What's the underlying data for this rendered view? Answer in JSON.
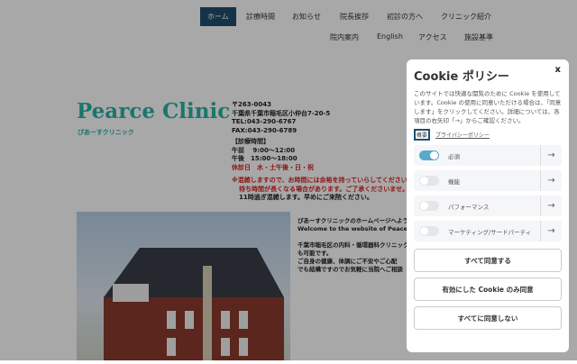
{
  "nav": {
    "row1": [
      "ホーム",
      "診療時間",
      "お知らせ",
      "院長挨拶",
      "初診の方へ",
      "クリニック紹介"
    ],
    "row2": [
      "院内案内",
      "English",
      "アクセス",
      "施設基準"
    ]
  },
  "logo": {
    "title": "Pearce Clinic",
    "subtitle": "ぴあーすクリニック"
  },
  "address": {
    "zip": "〒263-0043",
    "addr": "千葉県千葉市稲毛区小仲台7-20-5",
    "tel": "TEL:043-290-6767",
    "fax": "FAX:043-290-6789",
    "hours_title": "【診療時間】",
    "am": "午前　 9:00〜12:00",
    "pm": "午後　15:00〜18:00",
    "closed": "休診日　水・土午後・日・祝",
    "note1": "※混雑しますので、お時間には余裕を持っていらしてください",
    "note2": "待ち時間が長くなる場合があります。ご了承くださいませ。",
    "note3": "11時過ぎ混雑します。早めにご来院ください。"
  },
  "welcome": {
    "l1": "ぴあーすクリニックのホームページへようこそ",
    "l2": "Welcome to the website of Peace Clinic",
    "l3": "千葉市稲毛区の内科・循環器科クリニック",
    "l4": "も可能です。",
    "l5": "ご自身の健康、体調にご不安やご心配",
    "l6": "でも結構ですのでお気軽に当院へご相談"
  },
  "cookie": {
    "title": "Cookie ポリシー",
    "close": "x",
    "desc": "このサイトでは快適な閲覧のために Cookie を使用しています。Cookie の使用に同意いただける場合は、「同意します」をクリックしてください。詳細については、各項目の右矢印「→」からご確認ください。",
    "tag": "概要",
    "privacy": "プライバシーポリシー",
    "categories": [
      {
        "label": "必須",
        "on": true
      },
      {
        "label": "機能",
        "on": false
      },
      {
        "label": "パフォーマンス",
        "on": false
      },
      {
        "label": "マーケティング/サードパーティ",
        "on": false
      }
    ],
    "accept_all": "すべて同意する",
    "accept_selected": "有効にした Cookie のみ同意",
    "reject_all": "すべてに同意しない"
  }
}
